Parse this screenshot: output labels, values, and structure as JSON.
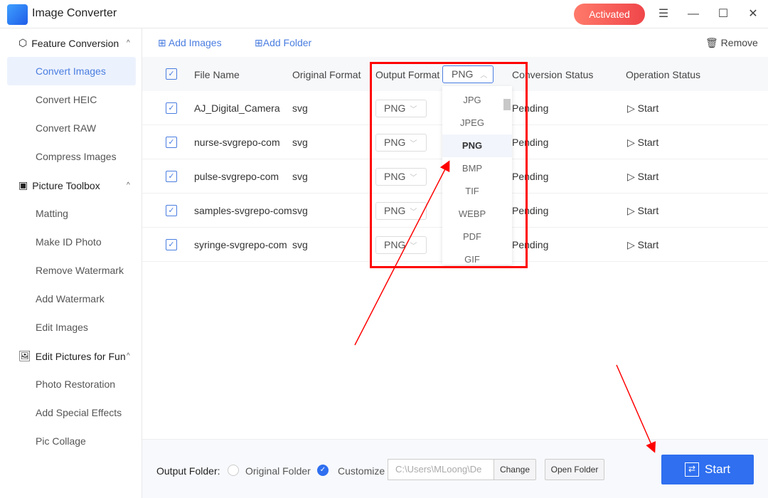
{
  "app": {
    "title": "Image Converter",
    "activated_label": "Activated"
  },
  "sidebar": {
    "sections": [
      {
        "label": "Feature Conversion",
        "items": [
          "Convert Images",
          "Convert HEIC",
          "Convert RAW",
          "Compress Images"
        ]
      },
      {
        "label": "Picture Toolbox",
        "items": [
          "Matting",
          "Make ID Photo",
          "Remove Watermark",
          "Add Watermark",
          "Edit Images"
        ]
      },
      {
        "label": "Edit Pictures for Fun",
        "items": [
          "Photo Restoration",
          "Add Special Effects",
          "Pic Collage"
        ]
      }
    ],
    "active_item": "Convert Images"
  },
  "toolbar": {
    "add_images": "Add Images",
    "add_folder": "Add Folder",
    "remove": "Remove"
  },
  "table": {
    "headers": {
      "file_name": "File Name",
      "original_format": "Original Format",
      "output_format": "Output Format",
      "conversion_status": "Conversion Status",
      "operation_status": "Operation Status"
    },
    "header_format_value": "PNG",
    "rows": [
      {
        "name": "AJ_Digital_Camera",
        "format": "svg",
        "output": "PNG",
        "status": "Pending",
        "action": "Start"
      },
      {
        "name": "nurse-svgrepo-com",
        "format": "svg",
        "output": "PNG",
        "status": "Pending",
        "action": "Start"
      },
      {
        "name": "pulse-svgrepo-com",
        "format": "svg",
        "output": "PNG",
        "status": "Pending",
        "action": "Start"
      },
      {
        "name": "samples-svgrepo-com",
        "format": "svg",
        "output": "PNG",
        "status": "Pending",
        "action": "Start"
      },
      {
        "name": "syringe-svgrepo-com",
        "format": "svg",
        "output": "PNG",
        "status": "Pending",
        "action": "Start"
      }
    ]
  },
  "dropdown": {
    "options": [
      "JPG",
      "JPEG",
      "PNG",
      "BMP",
      "TIF",
      "WEBP",
      "PDF",
      "GIF"
    ],
    "selected": "PNG"
  },
  "bottom": {
    "output_folder_label": "Output Folder:",
    "original_folder": "Original Folder",
    "customize": "Customize",
    "path": "C:\\Users\\MLoong\\De",
    "change": "Change",
    "open_folder": "Open Folder",
    "start": "Start",
    "selected_option": "Customize"
  },
  "colors": {
    "accent": "#2f6ff0",
    "annotation": "#ff0000",
    "activated": "#f0464a"
  }
}
